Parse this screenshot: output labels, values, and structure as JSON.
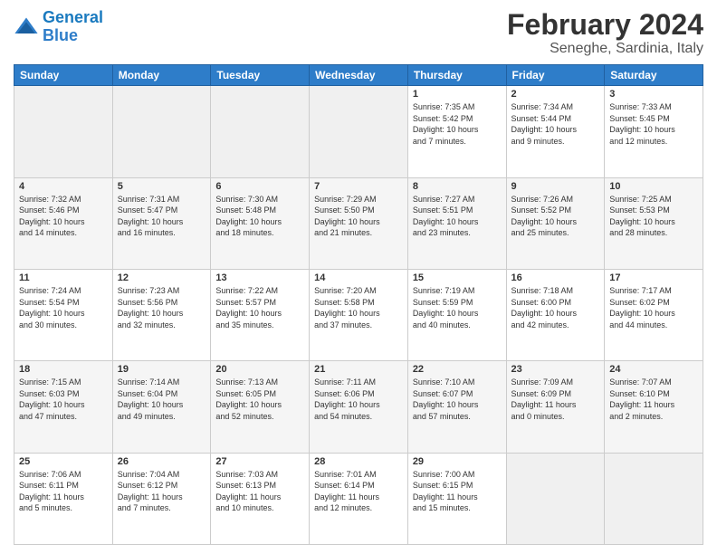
{
  "header": {
    "logo_line1": "General",
    "logo_line2": "Blue",
    "title": "February 2024",
    "subtitle": "Seneghe, Sardinia, Italy"
  },
  "weekdays": [
    "Sunday",
    "Monday",
    "Tuesday",
    "Wednesday",
    "Thursday",
    "Friday",
    "Saturday"
  ],
  "weeks": [
    [
      {
        "day": "",
        "info": ""
      },
      {
        "day": "",
        "info": ""
      },
      {
        "day": "",
        "info": ""
      },
      {
        "day": "",
        "info": ""
      },
      {
        "day": "1",
        "info": "Sunrise: 7:35 AM\nSunset: 5:42 PM\nDaylight: 10 hours\nand 7 minutes."
      },
      {
        "day": "2",
        "info": "Sunrise: 7:34 AM\nSunset: 5:44 PM\nDaylight: 10 hours\nand 9 minutes."
      },
      {
        "day": "3",
        "info": "Sunrise: 7:33 AM\nSunset: 5:45 PM\nDaylight: 10 hours\nand 12 minutes."
      }
    ],
    [
      {
        "day": "4",
        "info": "Sunrise: 7:32 AM\nSunset: 5:46 PM\nDaylight: 10 hours\nand 14 minutes."
      },
      {
        "day": "5",
        "info": "Sunrise: 7:31 AM\nSunset: 5:47 PM\nDaylight: 10 hours\nand 16 minutes."
      },
      {
        "day": "6",
        "info": "Sunrise: 7:30 AM\nSunset: 5:48 PM\nDaylight: 10 hours\nand 18 minutes."
      },
      {
        "day": "7",
        "info": "Sunrise: 7:29 AM\nSunset: 5:50 PM\nDaylight: 10 hours\nand 21 minutes."
      },
      {
        "day": "8",
        "info": "Sunrise: 7:27 AM\nSunset: 5:51 PM\nDaylight: 10 hours\nand 23 minutes."
      },
      {
        "day": "9",
        "info": "Sunrise: 7:26 AM\nSunset: 5:52 PM\nDaylight: 10 hours\nand 25 minutes."
      },
      {
        "day": "10",
        "info": "Sunrise: 7:25 AM\nSunset: 5:53 PM\nDaylight: 10 hours\nand 28 minutes."
      }
    ],
    [
      {
        "day": "11",
        "info": "Sunrise: 7:24 AM\nSunset: 5:54 PM\nDaylight: 10 hours\nand 30 minutes."
      },
      {
        "day": "12",
        "info": "Sunrise: 7:23 AM\nSunset: 5:56 PM\nDaylight: 10 hours\nand 32 minutes."
      },
      {
        "day": "13",
        "info": "Sunrise: 7:22 AM\nSunset: 5:57 PM\nDaylight: 10 hours\nand 35 minutes."
      },
      {
        "day": "14",
        "info": "Sunrise: 7:20 AM\nSunset: 5:58 PM\nDaylight: 10 hours\nand 37 minutes."
      },
      {
        "day": "15",
        "info": "Sunrise: 7:19 AM\nSunset: 5:59 PM\nDaylight: 10 hours\nand 40 minutes."
      },
      {
        "day": "16",
        "info": "Sunrise: 7:18 AM\nSunset: 6:00 PM\nDaylight: 10 hours\nand 42 minutes."
      },
      {
        "day": "17",
        "info": "Sunrise: 7:17 AM\nSunset: 6:02 PM\nDaylight: 10 hours\nand 44 minutes."
      }
    ],
    [
      {
        "day": "18",
        "info": "Sunrise: 7:15 AM\nSunset: 6:03 PM\nDaylight: 10 hours\nand 47 minutes."
      },
      {
        "day": "19",
        "info": "Sunrise: 7:14 AM\nSunset: 6:04 PM\nDaylight: 10 hours\nand 49 minutes."
      },
      {
        "day": "20",
        "info": "Sunrise: 7:13 AM\nSunset: 6:05 PM\nDaylight: 10 hours\nand 52 minutes."
      },
      {
        "day": "21",
        "info": "Sunrise: 7:11 AM\nSunset: 6:06 PM\nDaylight: 10 hours\nand 54 minutes."
      },
      {
        "day": "22",
        "info": "Sunrise: 7:10 AM\nSunset: 6:07 PM\nDaylight: 10 hours\nand 57 minutes."
      },
      {
        "day": "23",
        "info": "Sunrise: 7:09 AM\nSunset: 6:09 PM\nDaylight: 11 hours\nand 0 minutes."
      },
      {
        "day": "24",
        "info": "Sunrise: 7:07 AM\nSunset: 6:10 PM\nDaylight: 11 hours\nand 2 minutes."
      }
    ],
    [
      {
        "day": "25",
        "info": "Sunrise: 7:06 AM\nSunset: 6:11 PM\nDaylight: 11 hours\nand 5 minutes."
      },
      {
        "day": "26",
        "info": "Sunrise: 7:04 AM\nSunset: 6:12 PM\nDaylight: 11 hours\nand 7 minutes."
      },
      {
        "day": "27",
        "info": "Sunrise: 7:03 AM\nSunset: 6:13 PM\nDaylight: 11 hours\nand 10 minutes."
      },
      {
        "day": "28",
        "info": "Sunrise: 7:01 AM\nSunset: 6:14 PM\nDaylight: 11 hours\nand 12 minutes."
      },
      {
        "day": "29",
        "info": "Sunrise: 7:00 AM\nSunset: 6:15 PM\nDaylight: 11 hours\nand 15 minutes."
      },
      {
        "day": "",
        "info": ""
      },
      {
        "day": "",
        "info": ""
      }
    ]
  ]
}
